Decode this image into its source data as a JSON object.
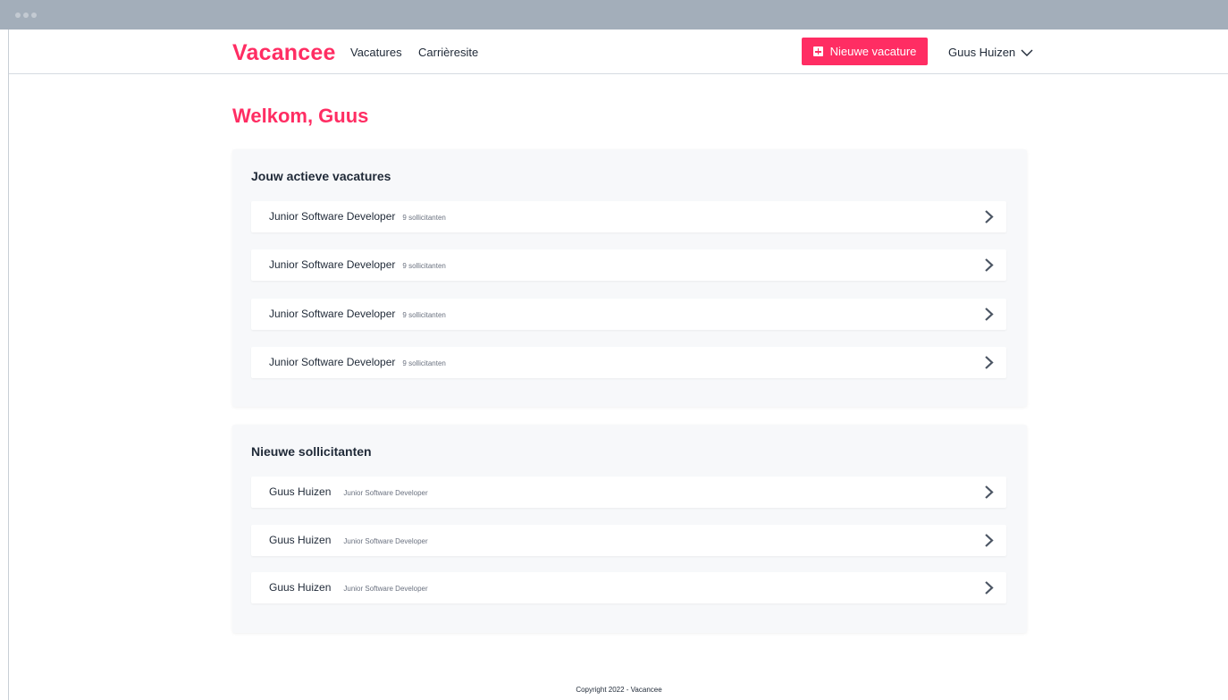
{
  "app": {
    "logo": "Vacancee",
    "nav": {
      "vacatures": "Vacatures",
      "carriere": "Carrièresite"
    },
    "new_button": "Nieuwe vacature",
    "user_name": "Guus Huizen",
    "accent_color": "#ff2d63"
  },
  "main": {
    "welcome": "Welkom, Guus",
    "active": {
      "title": "Jouw actieve vacatures",
      "items": [
        {
          "title": "Junior Software Developer",
          "meta": "9 sollicitanten"
        },
        {
          "title": "Junior Software Developer",
          "meta": "9 sollicitanten"
        },
        {
          "title": "Junior Software Developer",
          "meta": "9 sollicitanten"
        },
        {
          "title": "Junior Software Developer",
          "meta": "9 sollicitanten"
        }
      ]
    },
    "applicants": {
      "title": "Nieuwe sollicitanten",
      "items": [
        {
          "name": "Guus Huizen",
          "role": "Junior Software Developer"
        },
        {
          "name": "Guus Huizen",
          "role": "Junior Software Developer"
        },
        {
          "name": "Guus Huizen",
          "role": "Junior Software Developer"
        }
      ]
    }
  },
  "footer": {
    "copyright": "Copyright 2022 - Vacancee"
  },
  "icons": {
    "window_dots": "window-controls",
    "chevron_down": "chevron-down-icon",
    "chevron_right": "chevron-right-icon",
    "plus": "plus-square-icon"
  }
}
